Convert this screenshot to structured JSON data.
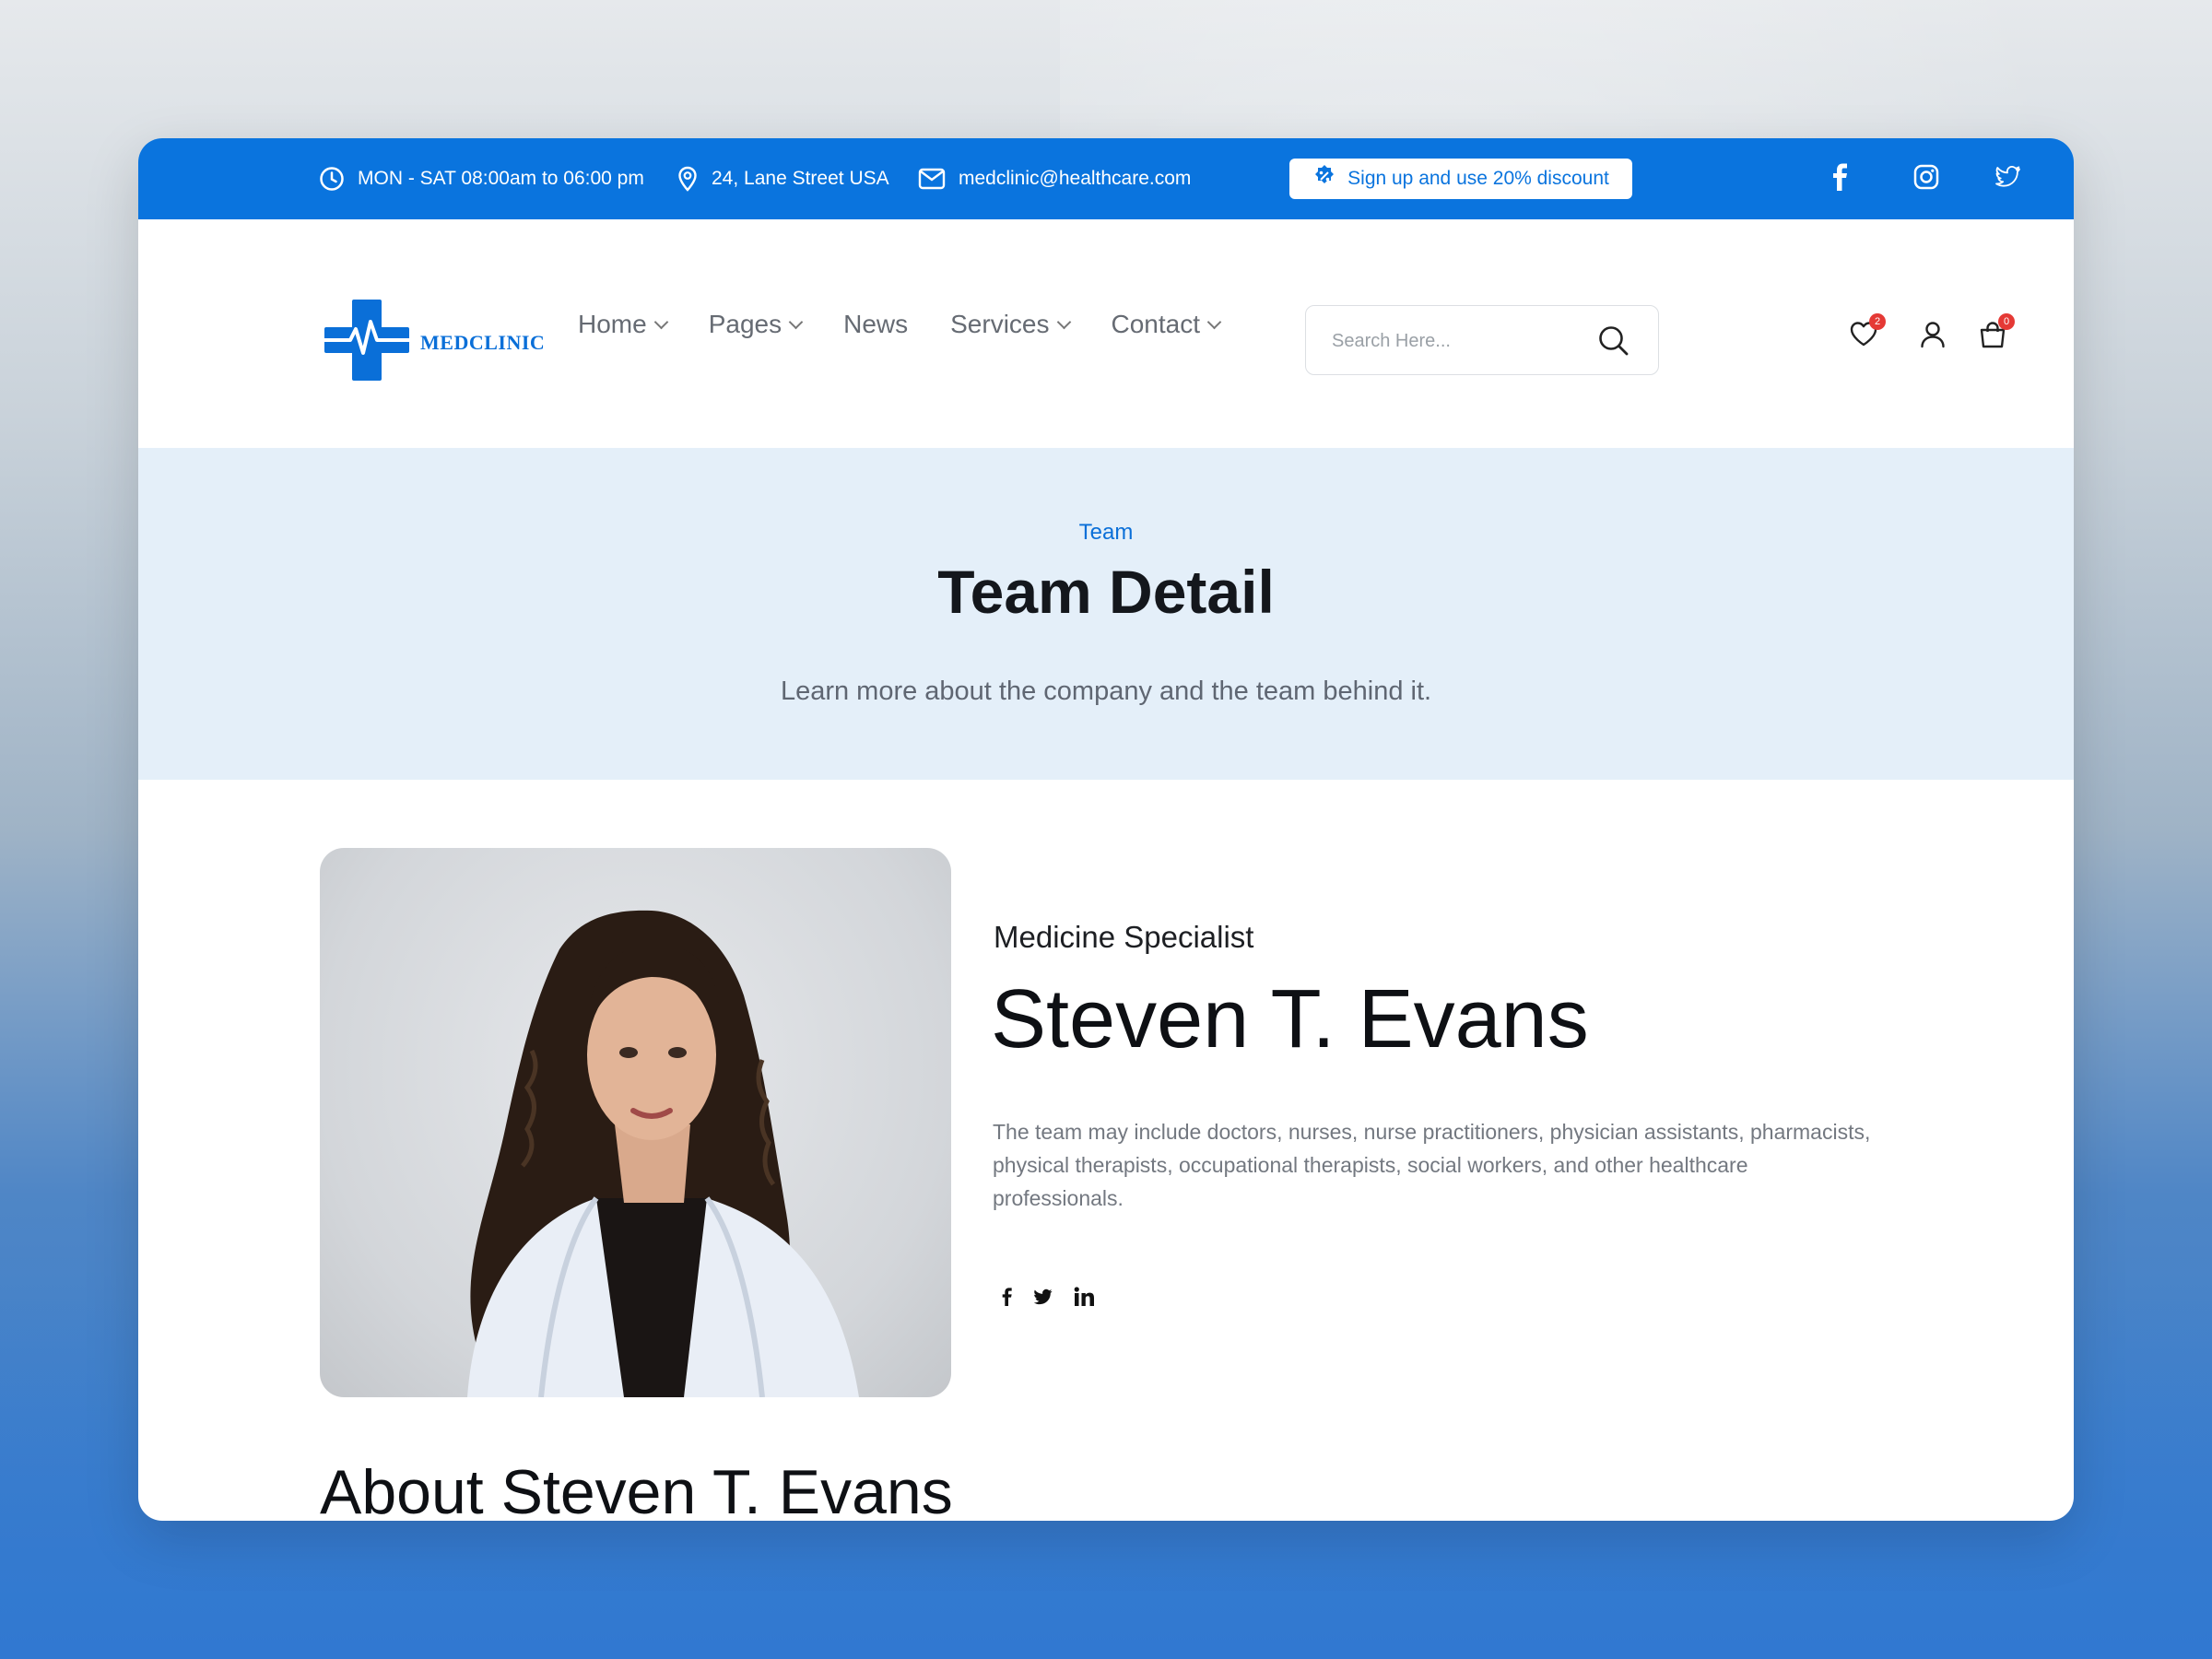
{
  "topbar": {
    "hours": "MON - SAT 08:00am to 06:00 pm",
    "address": "24, Lane Street USA",
    "email": "medclinic@healthcare.com",
    "discount": "Sign up and use 20% discount",
    "social_icons": [
      "facebook-icon",
      "instagram-icon",
      "twitter-icon"
    ]
  },
  "header": {
    "logo": "MEDCLINIC",
    "nav": [
      {
        "label": "Home",
        "dropdown": true
      },
      {
        "label": "Pages",
        "dropdown": true
      },
      {
        "label": "News",
        "dropdown": false
      },
      {
        "label": "Services",
        "dropdown": true
      },
      {
        "label": "Contact",
        "dropdown": true
      }
    ],
    "search": {
      "placeholder": "Search Here..."
    },
    "wishlist_count": "2",
    "cart_count": "0"
  },
  "banner": {
    "crumb": "Team",
    "title": "Team Detail",
    "subtitle": "Learn more about the company and the team behind it."
  },
  "profile": {
    "role": "Medicine Specialist",
    "name": "Steven T. Evans",
    "description": "The team may include doctors, nurses, nurse practitioners, physician assistants, pharmacists, physical therapists, occupational therapists, social workers, and other healthcare professionals.",
    "social_icons": [
      "facebook-icon",
      "twitter-icon",
      "linkedin-icon"
    ]
  },
  "about": {
    "title": "About Steven T. Evans"
  },
  "colors": {
    "primary": "#0a74de",
    "banner_bg": "#e4eff9",
    "badge": "#e53935"
  }
}
